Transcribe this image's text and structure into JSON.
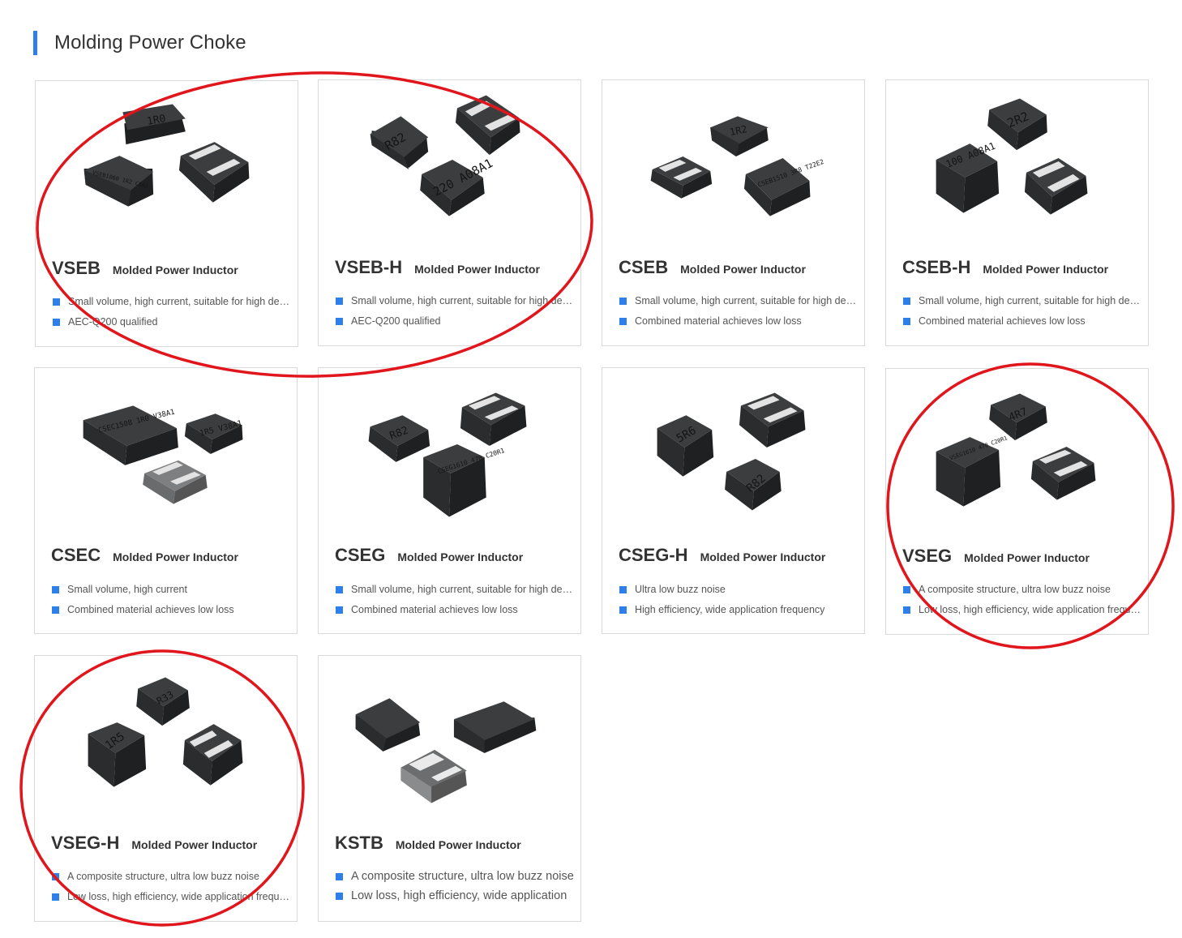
{
  "section": {
    "title": "Molding Power Choke"
  },
  "colors": {
    "accent": "#2f7fea",
    "annotation": "#e0161c",
    "card_border": "#d9d9d9",
    "chip_dark": "#3c3d3e"
  },
  "products": [
    {
      "name": "VSEB",
      "type": "Molded Power Inductor",
      "features": [
        "Small volume, high current, suitable for high density applications",
        "AEC-Q200 qualified"
      ],
      "chip_marks": [
        "1R0",
        "VSEB1060 1R2 C6A1",
        ""
      ]
    },
    {
      "name": "VSEB-H",
      "type": "Molded Power Inductor",
      "features": [
        "Small volume, high current, suitable for high density applications",
        "AEC-Q200 qualified"
      ],
      "chip_marks": [
        "R82",
        "",
        "220 A08A1"
      ]
    },
    {
      "name": "CSEB",
      "type": "Molded Power Inductor",
      "features": [
        "Small volume, high current, suitable for high density applications",
        "Combined material achieves low loss"
      ],
      "chip_marks": [
        "1R2",
        "",
        "CSEB1510 3R8 T22E2"
      ]
    },
    {
      "name": "CSEB-H",
      "type": "Molded Power Inductor",
      "features": [
        "Small volume, high current, suitable for high density applications",
        "Combined material achieves low loss"
      ],
      "chip_marks": [
        "2R2",
        "100 A08A1",
        ""
      ]
    },
    {
      "name": "CSEC",
      "type": "Molded Power Inductor",
      "features": [
        "Small volume, high current",
        "Combined material achieves low loss"
      ],
      "chip_marks": [
        "CSEC1508 1R0 V38A1",
        "1R5 V38A1",
        ""
      ]
    },
    {
      "name": "CSEG",
      "type": "Molded Power Inductor",
      "features": [
        "Small volume, high current, suitable for high density applications",
        "Combined material achieves low loss"
      ],
      "chip_marks": [
        "R82",
        "",
        "CSEG1610 470 C20R1"
      ]
    },
    {
      "name": "CSEG-H",
      "type": "Molded Power Inductor",
      "features": [
        "Ultra low buzz noise",
        "High efficiency, wide application frequency"
      ],
      "chip_marks": [
        "5R6",
        "",
        "R82"
      ]
    },
    {
      "name": "VSEG",
      "type": "Molded Power Inductor",
      "features": [
        "A composite structure, ultra low buzz noise",
        "Low loss, high efficiency, wide application frequency"
      ],
      "chip_marks": [
        "4R7",
        "VSEG1610 470 C20R1",
        ""
      ]
    },
    {
      "name": "VSEG-H",
      "type": "Molded Power Inductor",
      "features": [
        "A composite structure, ultra low buzz noise",
        "Low loss, high efficiency, wide application frequency"
      ],
      "chip_marks": [
        "R33",
        "1R5",
        ""
      ]
    },
    {
      "name": "KSTB",
      "type": "Molded Power Inductor",
      "features": [
        "A composite structure, ultra low buzz noise",
        "Low loss, high efficiency, wide application"
      ],
      "chip_marks": [
        "",
        "",
        ""
      ]
    }
  ]
}
